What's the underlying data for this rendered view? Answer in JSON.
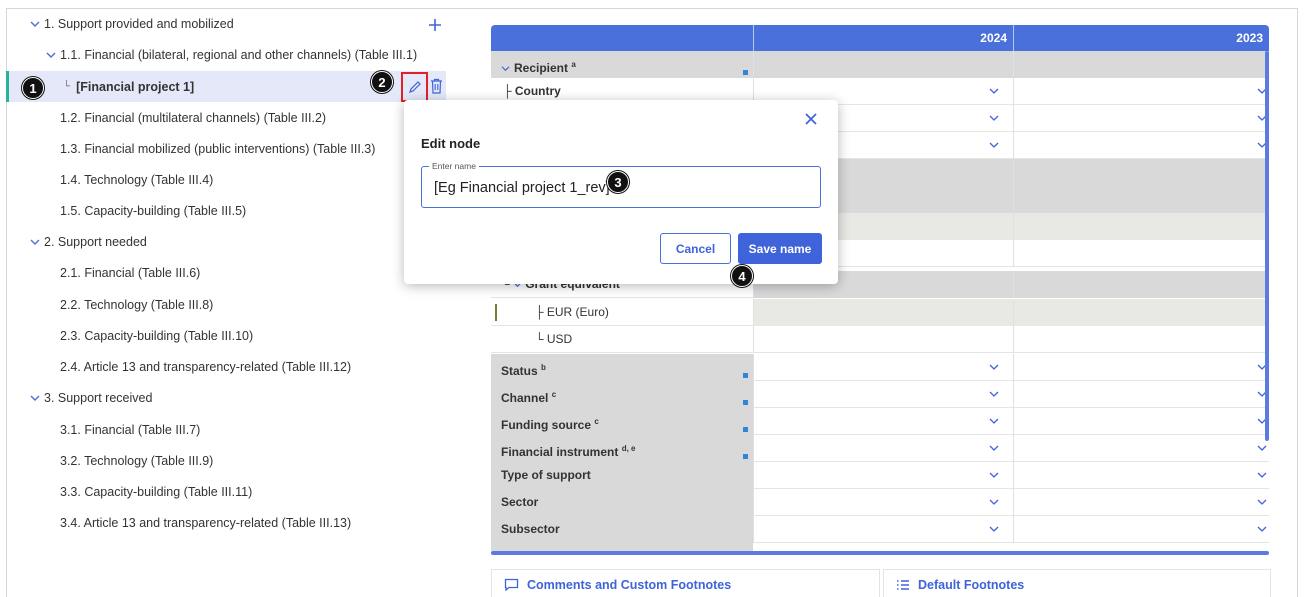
{
  "tree": {
    "items": [
      {
        "label": "1. Support provided and mobilized",
        "expanded": true
      },
      {
        "label": "1.1. Financial (bilateral, regional and other channels) (Table III.1)",
        "expanded": true
      },
      {
        "label": "[Financial project 1]",
        "prefix": "└",
        "selected": true
      },
      {
        "label": "1.2. Financial (multilateral channels) (Table III.2)"
      },
      {
        "label": "1.3. Financial mobilized (public interventions) (Table III.3)"
      },
      {
        "label": "1.4. Technology (Table III.4)"
      },
      {
        "label": "1.5. Capacity-building (Table III.5)"
      },
      {
        "label": "2. Support needed",
        "expanded": true
      },
      {
        "label": "2.1. Financial (Table III.6)"
      },
      {
        "label": "2.2. Technology (Table III.8)"
      },
      {
        "label": "2.3. Capacity-building (Table III.10)"
      },
      {
        "label": "2.4. Article 13 and transparency-related (Table III.12)"
      },
      {
        "label": "3. Support received",
        "expanded": true
      },
      {
        "label": "3.1. Financial (Table III.7)"
      },
      {
        "label": "3.2. Technology (Table III.9)"
      },
      {
        "label": "3.3. Capacity-building (Table III.11)"
      },
      {
        "label": "3.4. Article 13 and transparency-related (Table III.13)"
      }
    ],
    "add_icon": "plus-icon",
    "edit_icon": "pencil-icon",
    "delete_icon": "trash-icon"
  },
  "steps": [
    "1",
    "2",
    "3",
    "4"
  ],
  "table": {
    "columns": [
      "2024",
      "2023"
    ],
    "rows": {
      "recipient": {
        "label": "Recipient",
        "sup": "a"
      },
      "country": {
        "label": "Country",
        "prefix": "├"
      },
      "grant_equivalent": {
        "label": "Grant equivalent",
        "prefix": "└"
      },
      "eur": {
        "label": "EUR (Euro)",
        "prefix": "├"
      },
      "usd": {
        "label": "USD",
        "prefix": "└"
      },
      "status": {
        "label": "Status",
        "sup": "b"
      },
      "channel": {
        "label": "Channel",
        "sup": "c"
      },
      "funding_source": {
        "label": "Funding source",
        "sup": "c"
      },
      "financial_instrument": {
        "label": "Financial instrument",
        "sup": "d, e"
      },
      "type_of_support": {
        "label": "Type of support"
      },
      "sector": {
        "label": "Sector"
      },
      "subsector": {
        "label": "Subsector"
      }
    }
  },
  "footer_tabs": {
    "comments": "Comments and Custom Footnotes",
    "default": "Default Footnotes"
  },
  "modal": {
    "title": "Edit node",
    "field_label": "Enter name",
    "field_value": "[Eg Financial project 1_rev]",
    "cancel": "Cancel",
    "save": "Save name"
  },
  "colors": {
    "accent": "#3f63d9",
    "header": "#4a70dc",
    "selected_row": "#e4e8f8",
    "selected_marker": "#2bb39a",
    "highlight": "#e0202a"
  }
}
